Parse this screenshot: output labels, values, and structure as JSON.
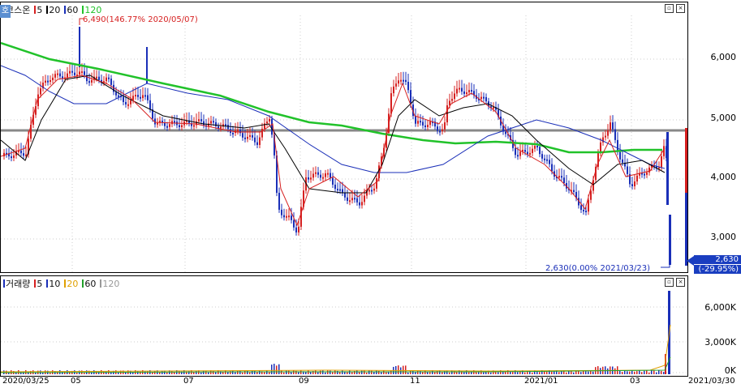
{
  "price_panel": {
    "badge": "호",
    "legend": [
      {
        "label": "코스온",
        "color": "#d62020"
      },
      {
        "label": "5",
        "color": "#d62020"
      },
      {
        "label": "20",
        "color": "#000000"
      },
      {
        "label": "60",
        "color": "#1a2fb8"
      },
      {
        "label": "120",
        "color": "#21c22a"
      }
    ],
    "high_note": "6,490(146.77% 2020/05/07)",
    "low_note": "2,630(0.00% 2021/03/23)",
    "y_ticks": [
      "6,000",
      "5,000",
      "4,000",
      "3,000"
    ],
    "last_price": "2,630",
    "last_change": "(-29.95%)"
  },
  "volume_panel": {
    "legend": [
      {
        "label": "거래량",
        "color": "#1a2fb8"
      },
      {
        "label": "5",
        "color": "#d62020"
      },
      {
        "label": "10",
        "color": "#1a2fb8"
      },
      {
        "label": "20",
        "color": "#e0a000"
      },
      {
        "label": "60",
        "color": "#21a02a"
      },
      {
        "label": "120",
        "color": "#999999"
      }
    ],
    "y_ticks": [
      "6,000K",
      "3,000K",
      "0K"
    ]
  },
  "x_axis": [
    "2020/03/25",
    "05",
    "07",
    "09",
    "11",
    "2021/01",
    "03",
    "2021/03/30"
  ],
  "colors": {
    "up": "#d62020",
    "down": "#1a2fb8",
    "ma5": "#d62020",
    "ma20": "#000000",
    "ma60": "#1a2fb8",
    "ma120": "#21c22a",
    "ref_line": "#888888"
  }
}
